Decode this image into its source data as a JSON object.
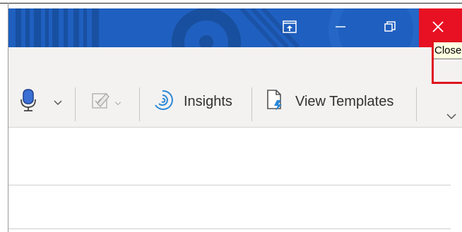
{
  "titlebar": {
    "buttons": {
      "upload": "upload-icon",
      "minimize": "minimize-icon",
      "restore": "restore-icon",
      "close": "close-icon"
    },
    "colors": {
      "background": "#1f5fbf",
      "close": "#e81123"
    }
  },
  "tooltip": {
    "text": "Close"
  },
  "ribbon": {
    "dictate_icon": "microphone-icon",
    "insights_label": "Insights",
    "view_templates_label": "View Templates"
  }
}
